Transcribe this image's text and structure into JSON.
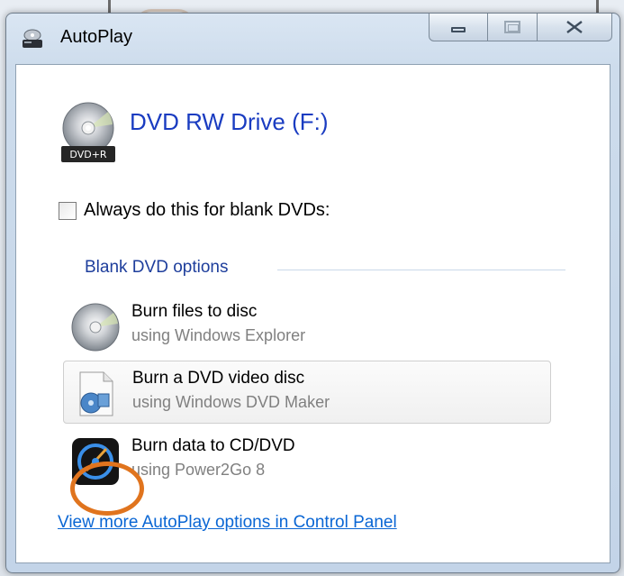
{
  "window": {
    "title": "AutoPlay",
    "icons": {
      "title_icon": "autoplay-icon"
    }
  },
  "caption": {
    "minimize_label": "",
    "maximize_label": "",
    "close_label": "✕"
  },
  "device": {
    "name": "DVD RW Drive (F:)",
    "icon_badge": "DVD+R",
    "icon": "dvd-disc-icon"
  },
  "always": {
    "label": "Always do this for blank DVDs:",
    "checked": false
  },
  "group": {
    "header": "Blank DVD options"
  },
  "options": [
    {
      "title": "Burn files to disc",
      "subtitle": "using Windows Explorer",
      "icon": "disc-icon"
    },
    {
      "title": "Burn a DVD video disc",
      "subtitle": "using Windows DVD Maker",
      "icon": "dvd-maker-icon"
    },
    {
      "title": "Burn data to CD/DVD",
      "subtitle": "using Power2Go 8",
      "icon": "power2go-icon"
    }
  ],
  "footer": {
    "control_panel_link": "View more AutoPlay options in Control Panel"
  },
  "colors": {
    "link": "#0a66d4",
    "heading": "#1a3cc1",
    "annotation": "#e0741e"
  }
}
